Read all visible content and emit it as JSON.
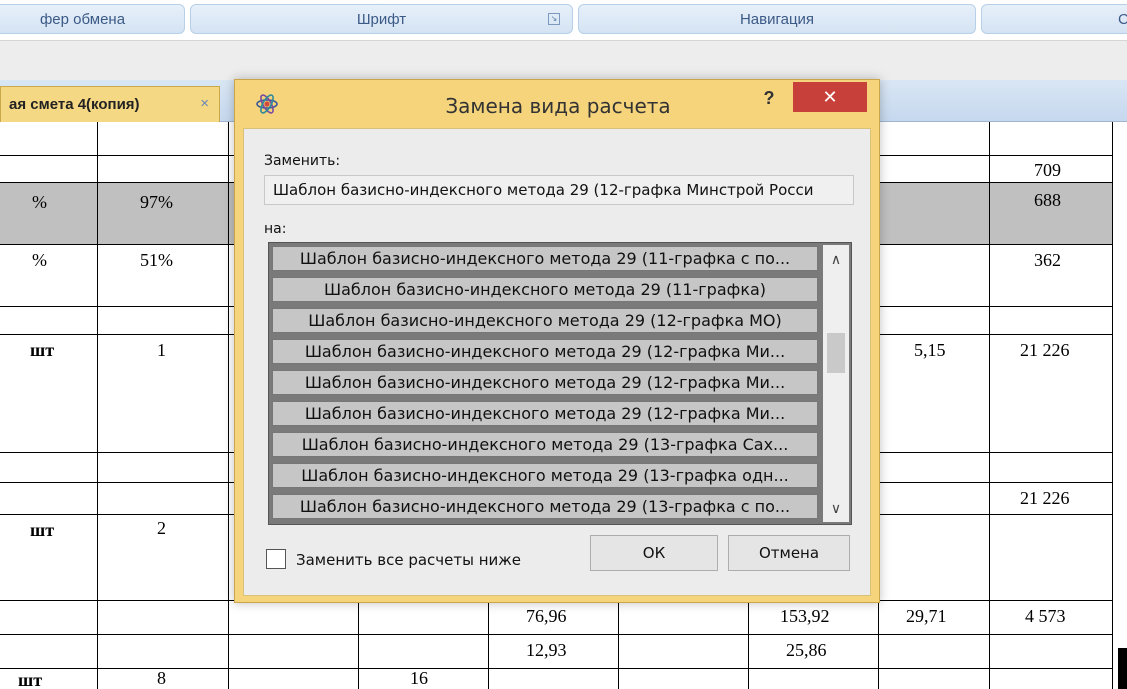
{
  "ribbon": {
    "groups": [
      "фер обмена",
      "Шрифт",
      "Навигация",
      "Сво"
    ]
  },
  "tab": {
    "label": "ая смета 4(копия)",
    "close": "×"
  },
  "sheet": {
    "cells": {
      "r1_h": "709",
      "r2_a": "%",
      "r2_b": "97%",
      "r2_h": "688",
      "r3_a": "%",
      "r3_b": "51%",
      "r3_h": "362",
      "r5_a": "шт",
      "r5_b": "1",
      "r5_g": "5,15",
      "r5_h": "21 226",
      "r7_h": "21 226",
      "r8_a": "шт",
      "r8_b": "2",
      "r9_d": "76,96",
      "r9_f": "153,92",
      "r9_g": "29,71",
      "r9_h": "4 573",
      "r10_d": "12,93",
      "r10_f": "25,86",
      "r11_a": "шт",
      "r11_b": "8",
      "r11_c": "16"
    }
  },
  "dialog": {
    "title": "Замена вида расчета",
    "help": "?",
    "close": "✕",
    "replace_label": "Заменить:",
    "replace_value": "Шаблон базисно-индексного метода 29 (12-графка Минстрой Росси",
    "with_label": "на:",
    "options": [
      "Шаблон базисно-индексного метода 29 (11-графка с по...",
      "Шаблон базисно-индексного метода 29 (11-графка)",
      "Шаблон базисно-индексного метода 29 (12-графка МО)",
      "Шаблон базисно-индексного метода 29 (12-графка Ми...",
      "Шаблон базисно-индексного метода 29 (12-графка Ми...",
      "Шаблон базисно-индексного метода 29 (12-графка Ми...",
      "Шаблон базисно-индексного метода 29 (13-графка Сах...",
      "Шаблон базисно-индексного метода 29 (13-графка одн...",
      "Шаблон базисно-индексного метода 29 (13-графка с по..."
    ],
    "scroll_up": "∧",
    "scroll_down": "∨",
    "checkbox_label": "Заменить все расчеты ниже",
    "checkbox_checked": false,
    "ok_label": "ОК",
    "cancel_label": "Отмена"
  },
  "colors": {
    "dialog_frame": "#f5d47c",
    "close_button": "#c8403a",
    "list_item_bg": "#c6c6c6",
    "gray_row": "#c0c0c0"
  }
}
